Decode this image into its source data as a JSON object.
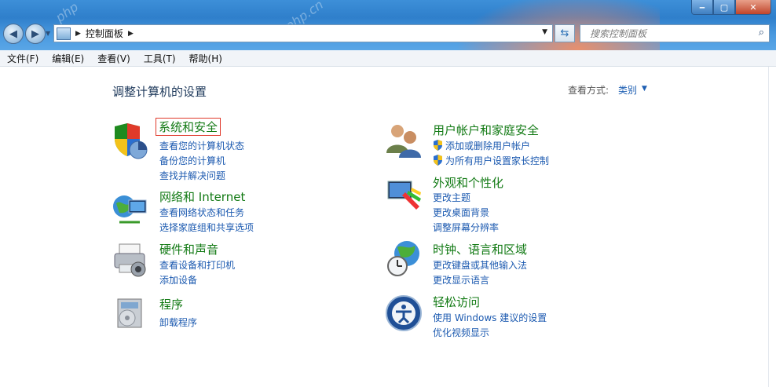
{
  "window": {
    "min_label": "‒",
    "max_label": "▢",
    "close_label": "✕"
  },
  "address": {
    "path_label": "控制面板",
    "search_placeholder": "搜索控制面板"
  },
  "menu": [
    "文件(F)",
    "编辑(E)",
    "查看(V)",
    "工具(T)",
    "帮助(H)"
  ],
  "header": {
    "title": "调整计算机的设置",
    "view_by_label": "查看方式:",
    "view_by_value": "类别"
  },
  "categories": [
    {
      "title": "系统和安全",
      "icon": "security-shield-icon",
      "links": [
        "查看您的计算机状态",
        "备份您的计算机",
        "查找并解决问题"
      ]
    },
    {
      "title": "网络和 Internet",
      "icon": "network-globe-icon",
      "links": [
        "查看网络状态和任务",
        "选择家庭组和共享选项"
      ]
    },
    {
      "title": "硬件和声音",
      "icon": "printer-hardware-icon",
      "links": [
        "查看设备和打印机",
        "添加设备"
      ]
    },
    {
      "title": "程序",
      "icon": "programs-box-icon",
      "links": [
        "卸载程序"
      ]
    },
    {
      "title": "用户帐户和家庭安全",
      "icon": "users-icon",
      "links": [
        "添加或删除用户帐户",
        "为所有用户设置家长控制"
      ]
    },
    {
      "title": "外观和个性化",
      "icon": "appearance-monitor-icon",
      "links": [
        "更改主题",
        "更改桌面背景",
        "调整屏幕分辨率"
      ]
    },
    {
      "title": "时钟、语言和区域",
      "icon": "clock-globe-icon",
      "links": [
        "更改键盘或其他输入法",
        "更改显示语言"
      ]
    },
    {
      "title": "轻松访问",
      "icon": "ease-of-access-icon",
      "links": [
        "使用 Windows 建议的设置",
        "优化视频显示"
      ]
    }
  ],
  "colors": {
    "category_title": "#127a14",
    "link": "#1c5ab0",
    "page_title": "#1e395b",
    "highlight_box": "#e0392b"
  }
}
